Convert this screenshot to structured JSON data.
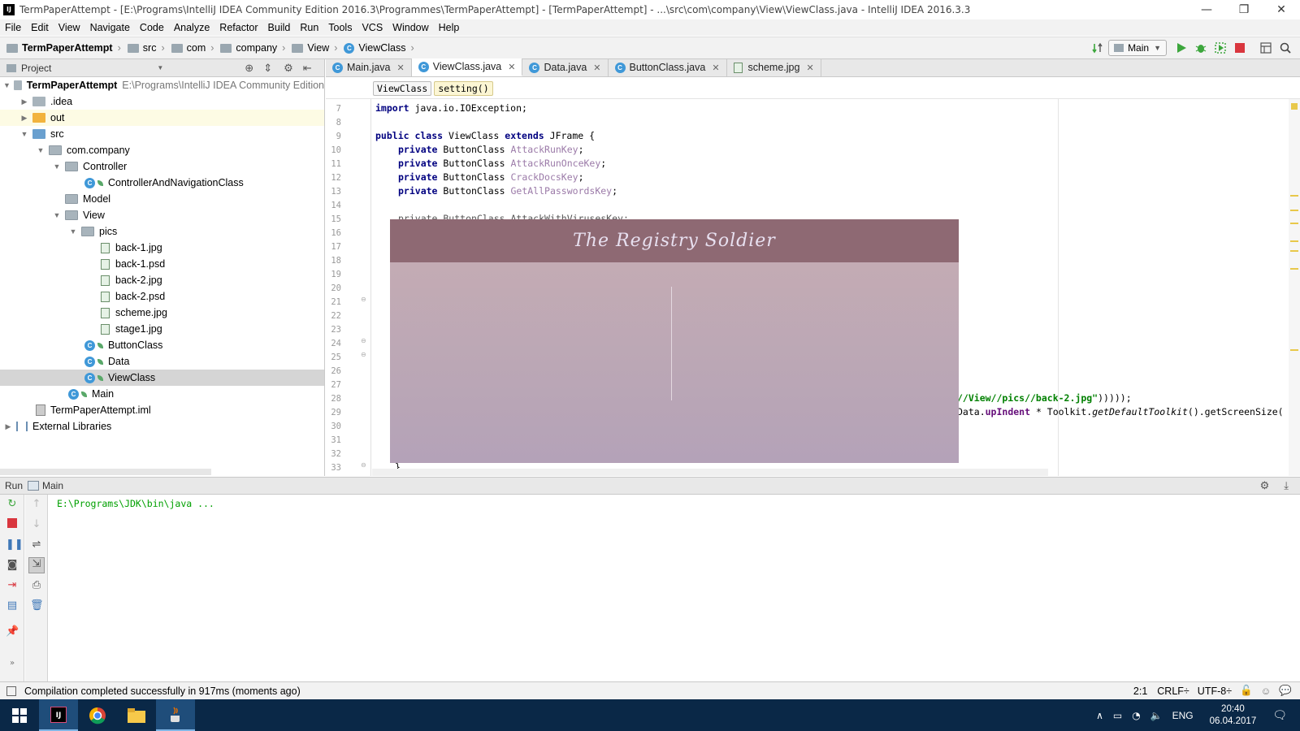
{
  "window": {
    "title": "TermPaperAttempt - [E:\\Programs\\IntelliJ IDEA Community Edition 2016.3\\Programmes\\TermPaperAttempt] - [TermPaperAttempt] - ...\\src\\com\\company\\View\\ViewClass.java - IntelliJ IDEA 2016.3.3",
    "minimize": "—",
    "restore": "❐",
    "close": "✕"
  },
  "menu": [
    "File",
    "Edit",
    "View",
    "Navigate",
    "Code",
    "Analyze",
    "Refactor",
    "Build",
    "Run",
    "Tools",
    "VCS",
    "Window",
    "Help"
  ],
  "breadcrumb": [
    "TermPaperAttempt",
    "src",
    "com",
    "company",
    "View",
    "ViewClass"
  ],
  "toolbar": {
    "run_config": "Main"
  },
  "project_panel": {
    "title": "Project",
    "tree": [
      {
        "label": "TermPaperAttempt",
        "hint": "E:\\Programs\\IntelliJ IDEA Community Edition"
      },
      {
        "label": ".idea"
      },
      {
        "label": "out"
      },
      {
        "label": "src"
      },
      {
        "label": "com.company"
      },
      {
        "label": "Controller"
      },
      {
        "label": "ControllerAndNavigationClass"
      },
      {
        "label": "Model"
      },
      {
        "label": "View"
      },
      {
        "label": "pics"
      },
      {
        "label": "back-1.jpg"
      },
      {
        "label": "back-1.psd"
      },
      {
        "label": "back-2.jpg"
      },
      {
        "label": "back-2.psd"
      },
      {
        "label": "scheme.jpg"
      },
      {
        "label": "stage1.jpg"
      },
      {
        "label": "ButtonClass"
      },
      {
        "label": "Data"
      },
      {
        "label": "ViewClass"
      },
      {
        "label": "Main"
      },
      {
        "label": "TermPaperAttempt.iml"
      },
      {
        "label": "External Libraries"
      }
    ]
  },
  "tabs": [
    {
      "label": "Main.java",
      "active": false
    },
    {
      "label": "ViewClass.java",
      "active": true
    },
    {
      "label": "Data.java",
      "active": false
    },
    {
      "label": "ButtonClass.java",
      "active": false
    },
    {
      "label": "scheme.jpg",
      "active": false
    }
  ],
  "editor_breadcrumb": [
    "ViewClass",
    "setting()"
  ],
  "editor": {
    "line_numbers": [
      "7",
      "8",
      "9",
      "10",
      "11",
      "12",
      "13",
      "14",
      "15",
      "16",
      "17",
      "18",
      "19",
      "20",
      "21",
      "22",
      "23",
      "24",
      "25",
      "26",
      "27",
      "28",
      "29",
      "30",
      "31",
      "32",
      "33"
    ],
    "lines": {
      "l7_kw": "import",
      "l7_rest": " java.io.IOException;",
      "l9_kw1": "public class",
      "l9_mid": " ViewClass ",
      "l9_kw2": "extends",
      "l9_rest": " JFrame {",
      "l10_kw": "private",
      "l10_type": " ButtonClass ",
      "l10_field": "AttackRunKey",
      "l10_end": ";",
      "l11_kw": "private",
      "l11_type": " ButtonClass ",
      "l11_field": "AttackRunOnceKey",
      "l11_end": ";",
      "l12_kw": "private",
      "l12_type": " ButtonClass ",
      "l12_field": "CrackDocsKey",
      "l12_end": ";",
      "l13_kw": "private",
      "l13_type": " ButtonClass ",
      "l13_field": "GetAllPasswordsKey",
      "l13_end": ";",
      "l15_partial": "private ButtonClass AttackWithVirusesKey;",
      "l28_str": "//View//pics//back-2.jpg\"",
      "l28_end": ")))));",
      "l29_a": "Data.",
      "l29_fld": "upIndent",
      "l29_b": " * Toolkit.",
      "l29_it": "getDefaultToolkit",
      "l29_c": "().getScreenSize(",
      "l33": "}"
    }
  },
  "overlay_window": {
    "title": "The Registry Soldier"
  },
  "run_panel": {
    "tab_label": "Run",
    "config": "Main",
    "console_line": "E:\\Programs\\JDK\\bin\\java ..."
  },
  "statusbar": {
    "message": "Compilation completed successfully in 917ms (moments ago)",
    "position": "2:1",
    "line_sep": "CRLF÷",
    "encoding": "UTF-8÷"
  },
  "taskbar": {
    "language": "ENG",
    "time": "20:40",
    "date": "06.04.2017"
  },
  "colors": {
    "overlay_header": "#8e6973",
    "overlay_body": "#c0aab6",
    "taskbar": "#0a2847",
    "run_green": "#3ca63c",
    "stop_red": "#d9363e"
  }
}
